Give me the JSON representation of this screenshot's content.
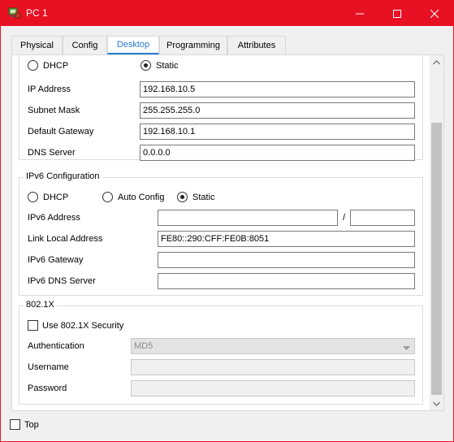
{
  "window": {
    "title": "PC 1",
    "accent": "#e81123",
    "icon": "pc-app-icon"
  },
  "tabs": [
    {
      "label": "Physical",
      "active": false
    },
    {
      "label": "Config",
      "active": false
    },
    {
      "label": "Desktop",
      "active": true
    },
    {
      "label": "Programming",
      "active": false
    },
    {
      "label": "Attributes",
      "active": false
    }
  ],
  "ipv4": {
    "dhcp_label": "DHCP",
    "static_label": "Static",
    "mode": "Static",
    "ip_address_label": "IP Address",
    "ip_address": "192.168.10.5",
    "subnet_mask_label": "Subnet Mask",
    "subnet_mask": "255.255.255.0",
    "gateway_label": "Default Gateway",
    "gateway": "192.168.10.1",
    "dns_label": "DNS Server",
    "dns": "0.0.0.0"
  },
  "ipv6": {
    "section_title": "IPv6 Configuration",
    "dhcp_label": "DHCP",
    "auto_label": "Auto Config",
    "static_label": "Static",
    "mode": "Static",
    "address_label": "IPv6 Address",
    "address": "",
    "prefix_separator": "/",
    "prefix": "",
    "link_local_label": "Link Local Address",
    "link_local": "FE80::290:CFF:FE0B:8051",
    "gateway_label": "IPv6 Gateway",
    "gateway": "",
    "dns_label": "IPv6 DNS Server",
    "dns": ""
  },
  "dot1x": {
    "section_title": "802.1X",
    "use_label": "Use 802.1X Security",
    "use_checked": false,
    "auth_label": "Authentication",
    "auth_value": "MD5",
    "username_label": "Username",
    "username": "",
    "password_label": "Password",
    "password": ""
  },
  "footer": {
    "top_label": "Top",
    "top_checked": false
  }
}
